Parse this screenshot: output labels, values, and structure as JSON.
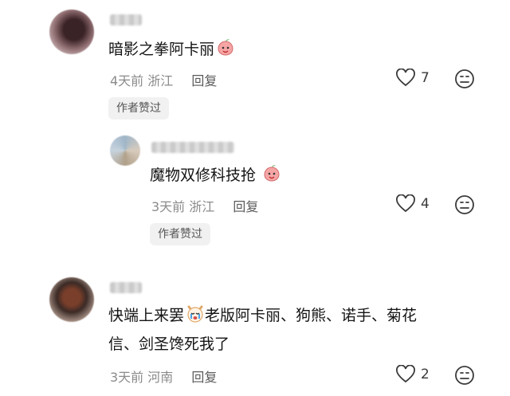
{
  "comments": [
    {
      "text": "暗影之拳阿卡丽",
      "time": "4天前",
      "location": "浙江",
      "reply_label": "回复",
      "likes": "7",
      "author_liked_label": "作者赞过",
      "emoji_icon": "peach-face-icon"
    },
    {
      "text": "魔物双修科技抢",
      "time": "3天前",
      "location": "浙江",
      "reply_label": "回复",
      "likes": "4",
      "author_liked_label": "作者赞过",
      "emoji_icon": "peach-face-icon"
    },
    {
      "text_before_emoji": "快端上来罢",
      "text_after_emoji": "老版阿卡丽、狗熊、诺手、菊花",
      "text_line2": "信、剑圣馋死我了",
      "time": "3天前",
      "location": "河南",
      "reply_label": "回复",
      "likes": "2",
      "emoji_icon": "crying-dog-icon"
    }
  ],
  "colors": {
    "text": "#141414",
    "meta": "#8b8b8b",
    "badge_bg": "#f1f1f1",
    "peach": "#f4a0a0"
  }
}
